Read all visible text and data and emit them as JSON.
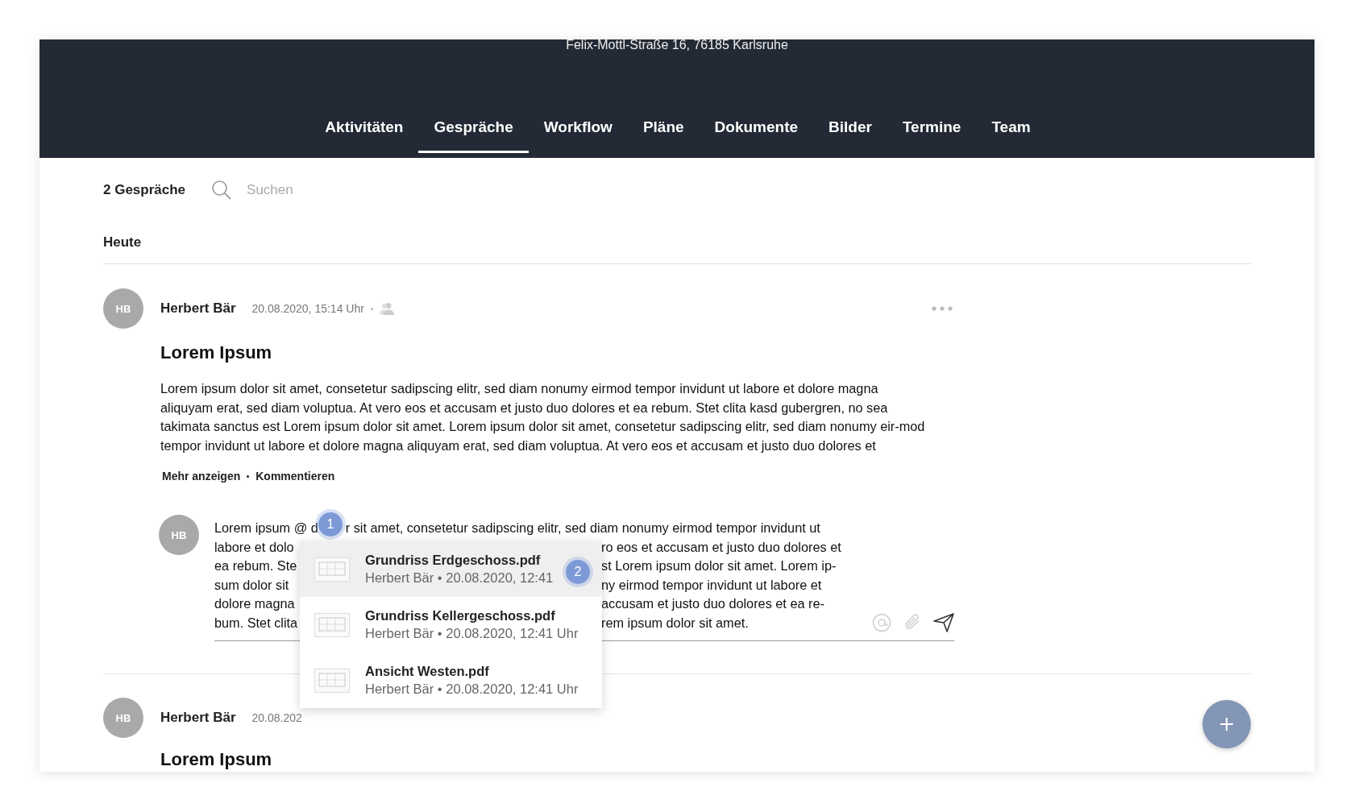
{
  "header": {
    "address": "Felix-Mottl-Straße 16, 76185 Karlsruhe"
  },
  "tabs": [
    {
      "label": "Aktivitäten",
      "selected": false
    },
    {
      "label": "Gespräche",
      "selected": true
    },
    {
      "label": "Workflow",
      "selected": false
    },
    {
      "label": "Pläne",
      "selected": false
    },
    {
      "label": "Dokumente",
      "selected": false
    },
    {
      "label": "Bilder",
      "selected": false
    },
    {
      "label": "Termine",
      "selected": false
    },
    {
      "label": "Team",
      "selected": false
    }
  ],
  "toolbar": {
    "count": "2 Gespräche",
    "search": {
      "placeholder": "Suchen"
    }
  },
  "section": "Heute",
  "posts": [
    {
      "avatar": "HB",
      "author": "Herbert Bär",
      "date": "20.08.2020, 15:14 Uhr",
      "title": "Lorem Ipsum",
      "body": "Lorem ipsum dolor sit amet, consetetur sadipscing elitr, sed diam nonumy eirmod tempor invidunt ut labore et dolore magna aliquyam erat, sed diam voluptua. At vero eos et accusam et justo duo dolores et ea rebum. Stet clita kasd gubergren, no sea takimata sanctus est Lorem ipsum dolor sit amet. Lorem ipsum dolor sit amet, consetetur sadipscing elitr, sed diam nonumy eir-mod tempor invidunt ut labore et dolore magna aliquyam erat, sed diam voluptua. At vero eos et accusam et justo duo dolores et",
      "actions": [
        "Mehr anzeigen",
        "Kommentieren"
      ]
    },
    {
      "avatar": "HB",
      "author": "Herbert Bär",
      "date": "20.08.202",
      "title": "Lorem Ipsum"
    }
  ],
  "comment": {
    "avatar": "HB",
    "lines": [
      [
        "Lorem ipsum @ d",
        "r sit amet, consetetur sadipscing elitr, sed diam nonumy eirmod tempor invidunt ut"
      ],
      [
        "labore et dolo",
        "ro eos et accusam et justo duo dolores et"
      ],
      [
        "ea rebum. Ste",
        "st Lorem ipsum dolor sit amet. Lorem ip-"
      ],
      [
        "sum dolor sit",
        "ny eirmod tempor invidunt ut labore et"
      ],
      [
        "dolore magna",
        "accusam et justo duo dolores et ea re-"
      ],
      [
        "bum. Stet clita",
        "rem ipsum dolor sit amet."
      ]
    ]
  },
  "suggestions": [
    {
      "name": "Grundriss Erdgeschoss.pdf",
      "meta": "Herbert Bär • 20.08.2020, 12:41",
      "selected": true
    },
    {
      "name": "Grundriss Kellergeschoss.pdf",
      "meta": "Herbert Bär • 20.08.2020, 12:41 Uhr",
      "selected": false
    },
    {
      "name": "Ansicht Westen.pdf",
      "meta": "Herbert Bär • 20.08.2020, 12:41 Uhr",
      "selected": false
    }
  ],
  "markers": [
    "1",
    "2"
  ]
}
